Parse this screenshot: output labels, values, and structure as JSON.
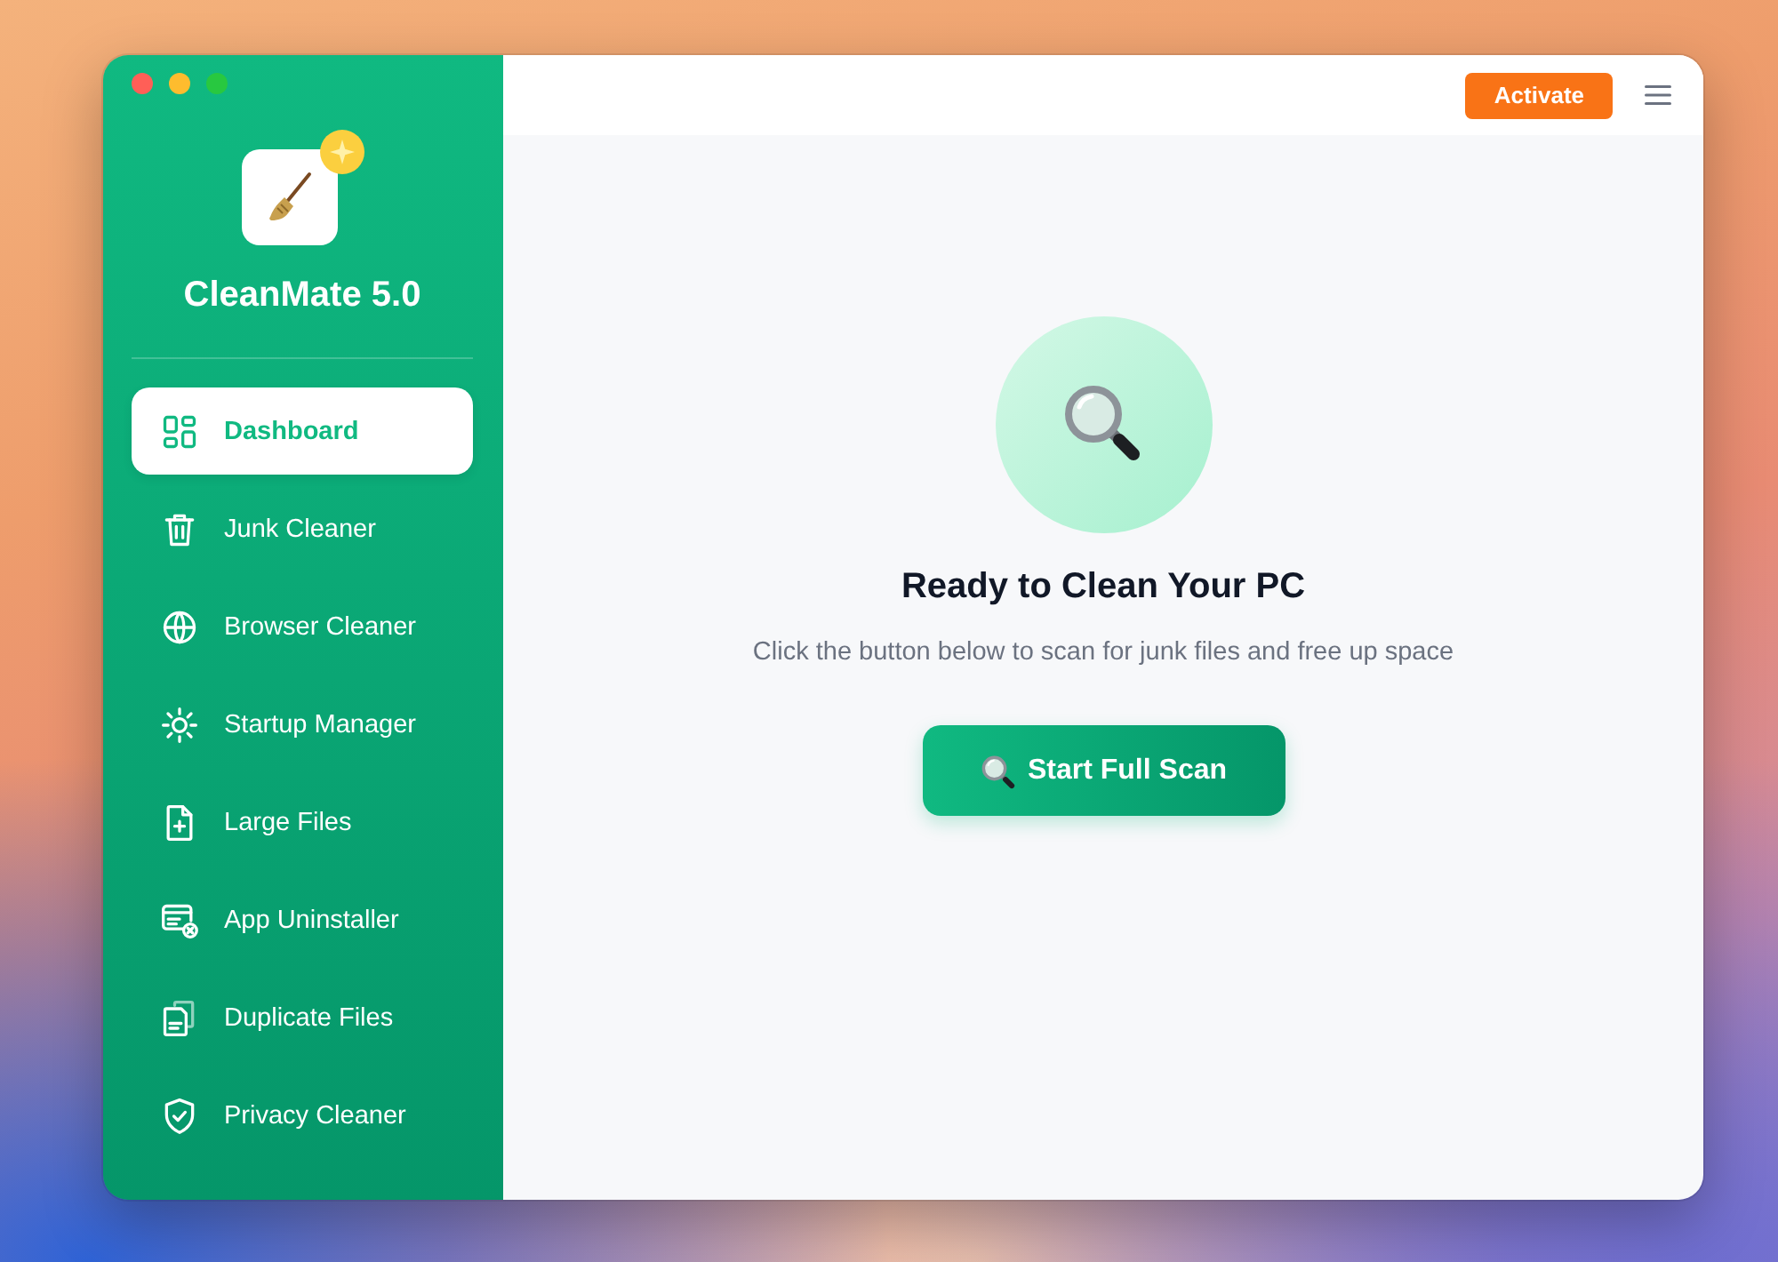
{
  "sidebar": {
    "app_name": "CleanMate 5.0",
    "items": [
      {
        "label": "Dashboard",
        "selected": true
      },
      {
        "label": "Junk Cleaner",
        "selected": false
      },
      {
        "label": "Browser Cleaner",
        "selected": false
      },
      {
        "label": "Startup Manager",
        "selected": false
      },
      {
        "label": "Large Files",
        "selected": false
      },
      {
        "label": "App Uninstaller",
        "selected": false
      },
      {
        "label": "Duplicate Files",
        "selected": false
      },
      {
        "label": "Privacy Cleaner",
        "selected": false
      }
    ]
  },
  "top_bar": {
    "activate_button": "Activate"
  },
  "main": {
    "title": "Ready to Clean Your PC",
    "subtitle": "Click the button below to scan for junk files and free up space",
    "scan_button": "Start Full Scan"
  }
}
